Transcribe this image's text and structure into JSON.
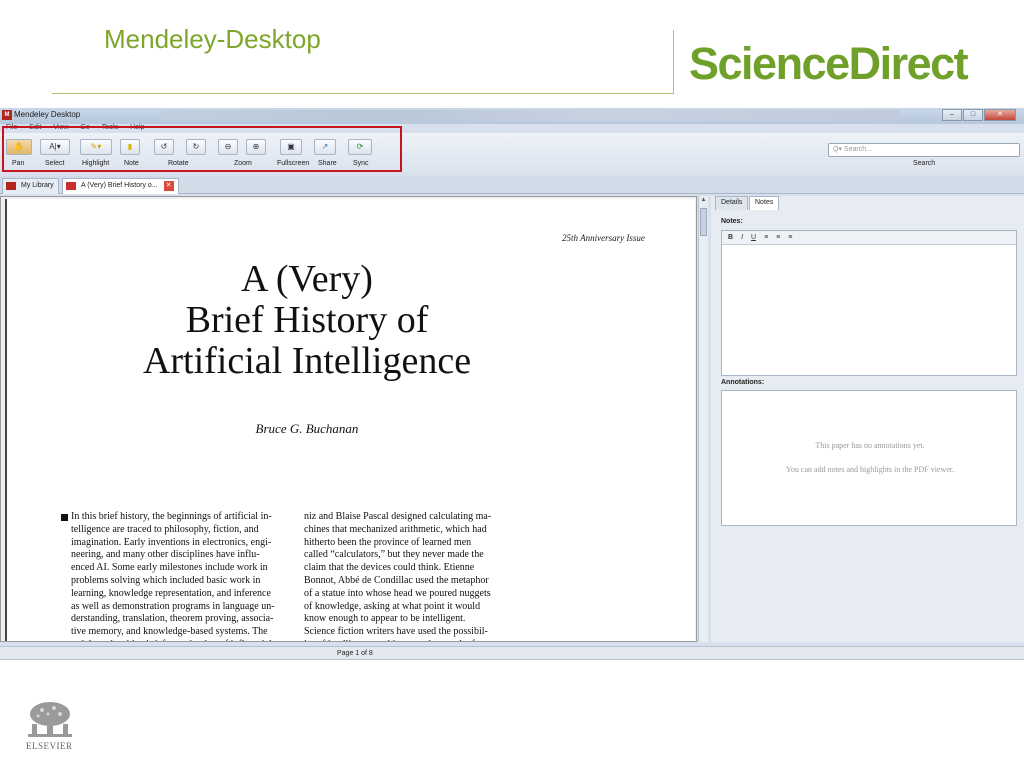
{
  "slide": {
    "title": "Mendeley-Desktop",
    "brand": "ScienceDirect",
    "publisher": "ELSEVIER"
  },
  "window": {
    "title": "Mendeley Desktop",
    "app_icon": "mendeley-icon",
    "controls": [
      "minimize",
      "maximize",
      "close"
    ]
  },
  "menu": [
    "File",
    "Edit",
    "View",
    "Go",
    "Tools",
    "Help"
  ],
  "toolbar": {
    "tools": [
      {
        "label": "Pan",
        "icon": "hand-icon"
      },
      {
        "label": "Select",
        "icon": "text-select-icon"
      },
      {
        "label": "Highlight",
        "icon": "highlighter-icon"
      },
      {
        "label": "Note",
        "icon": "sticky-note-icon"
      },
      {
        "label": "Rotate",
        "icon": "rotate-icon"
      },
      {
        "label": "Zoom",
        "icon": "zoom-icon"
      },
      {
        "label": "Fullscreen",
        "icon": "fullscreen-icon"
      },
      {
        "label": "Share",
        "icon": "share-icon"
      },
      {
        "label": "Sync",
        "icon": "sync-icon"
      }
    ],
    "search_placeholder": "Q▾ Search...",
    "search_label": "Search",
    "highlight_color": "#c4161c"
  },
  "tabs": [
    {
      "label": "My Library"
    },
    {
      "label": "A (Very) Brief History o..."
    }
  ],
  "document": {
    "issue": "25th Anniversary Issue",
    "title_line1": "A (Very)",
    "title_line2": "Brief History of",
    "title_line3": "Artificial Intelligence",
    "author": "Bruce G. Buchanan",
    "col_left": "In this brief history, the beginnings of artificial in-\ntelligence are traced to philosophy, fiction, and\nimagination. Early inventions in electronics, engi-\nneering, and many other disciplines have influ-\nenced AI. Some early milestones include work in\nproblems solving which included basic work in\nlearning, knowledge representation, and inference\nas well as demonstration programs in language un-\nderstanding, translation, theorem proving, associa-\ntive memory, and knowledge-based systems. The\narticle ends with a brief examination of influential",
    "col_right": "niz and Blaise Pascal designed calculating ma-\nchines that mechanized arithmetic, which had\nhitherto been the province of learned men\ncalled “calculators,” but they never made the\nclaim that the devices could think. Etienne\nBonnot, Abbé de Condillac used the metaphor\nof a statue into whose head we poured nuggets\nof knowledge, asking at what point it would\nknow enough to appear to be intelligent.\n    Science fiction writers have used the possibil-\nity of intelligent machines to advance the fan-"
  },
  "side_panel": {
    "tabs": [
      "Details",
      "Notes"
    ],
    "notes_label": "Notes:",
    "format_buttons": [
      "B",
      "I",
      "U",
      "≡",
      "≡",
      "≡"
    ],
    "annotations_label": "Annotations:",
    "annotations_msg1": "This paper has no annotations yet.",
    "annotations_msg2": "You can add notes and highlights in the PDF viewer."
  },
  "status": {
    "page_indicator": "Page 1 of 8"
  }
}
